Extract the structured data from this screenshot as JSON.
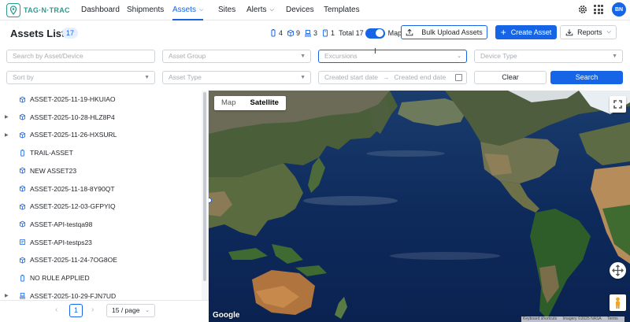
{
  "logo": {
    "text": "TAG·N·TRAC",
    "icon": "pin-icon"
  },
  "nav": {
    "items": [
      {
        "label": "Dashboard"
      },
      {
        "label": "Shipments"
      },
      {
        "label": "Assets",
        "active": true,
        "has_dropdown": true
      },
      {
        "label": "Sites"
      },
      {
        "label": "Alerts",
        "has_dropdown": true
      },
      {
        "label": "Devices"
      },
      {
        "label": "Templates"
      }
    ],
    "avatar_initials": "BN"
  },
  "header": {
    "title": "Assets List",
    "count": "17",
    "stats": [
      {
        "icon": "tracker-icon",
        "value": "4"
      },
      {
        "icon": "box-icon",
        "value": "9"
      },
      {
        "icon": "pallet-icon",
        "value": "3"
      },
      {
        "icon": "card-icon",
        "value": "1"
      }
    ],
    "total_label": "Total 17",
    "map_toggle_label": "Map",
    "map_toggle_on": true,
    "bulk_upload_label": "Bulk Upload Assets",
    "create_label": "Create Asset",
    "reports_label": "Reports"
  },
  "filters": {
    "search_placeholder": "Search by Asset/Device",
    "asset_group_placeholder": "Asset Group",
    "excursions_placeholder": "Excursions",
    "device_type_placeholder": "Device Type",
    "sort_by_placeholder": "Sort by",
    "asset_type_placeholder": "Asset Type",
    "start_date_placeholder": "Created start date",
    "end_date_placeholder": "Created end date",
    "clear_label": "Clear",
    "search_label": "Search"
  },
  "assets": [
    {
      "name": "ASSET-2025-11-19-HKUIAO",
      "icon": "box-icon",
      "expandable": false
    },
    {
      "name": "ASSET-2025-10-28-HLZ8P4",
      "icon": "box-icon",
      "expandable": true
    },
    {
      "name": "ASSET-2025-11-26-HXSURL",
      "icon": "box-icon",
      "expandable": true
    },
    {
      "name": "TRAIL-ASSET",
      "icon": "tracker-icon",
      "expandable": false
    },
    {
      "name": "NEW ASSET23",
      "icon": "box-icon",
      "expandable": false
    },
    {
      "name": "ASSET-2025-11-18-8Y90QT",
      "icon": "box-icon",
      "expandable": false
    },
    {
      "name": "ASSET-2025-12-03-GFPYIQ",
      "icon": "box-icon",
      "expandable": false
    },
    {
      "name": "ASSET-API-testqa98",
      "icon": "box-icon",
      "expandable": false
    },
    {
      "name": "ASSET-API-testps23",
      "icon": "card-icon",
      "expandable": false
    },
    {
      "name": "ASSET-2025-11-24-7OG8OE",
      "icon": "box-icon",
      "expandable": false
    },
    {
      "name": "NO RULE APPLIED",
      "icon": "tracker-icon",
      "expandable": false
    },
    {
      "name": "ASSET-2025-10-29-FJN7UD",
      "icon": "pallet-icon",
      "expandable": true
    }
  ],
  "pagination": {
    "current_page": "1",
    "page_size": "15 / page"
  },
  "map": {
    "tab_map": "Map",
    "tab_satellite": "Satellite",
    "active_tab": "Satellite",
    "google_label": "Google",
    "attribution": [
      "Keyboard shortcuts",
      "Imagery ©2025 NASA",
      "Terms"
    ]
  },
  "colors": {
    "accent": "#1565e6",
    "brand": "#2a9b8e"
  }
}
